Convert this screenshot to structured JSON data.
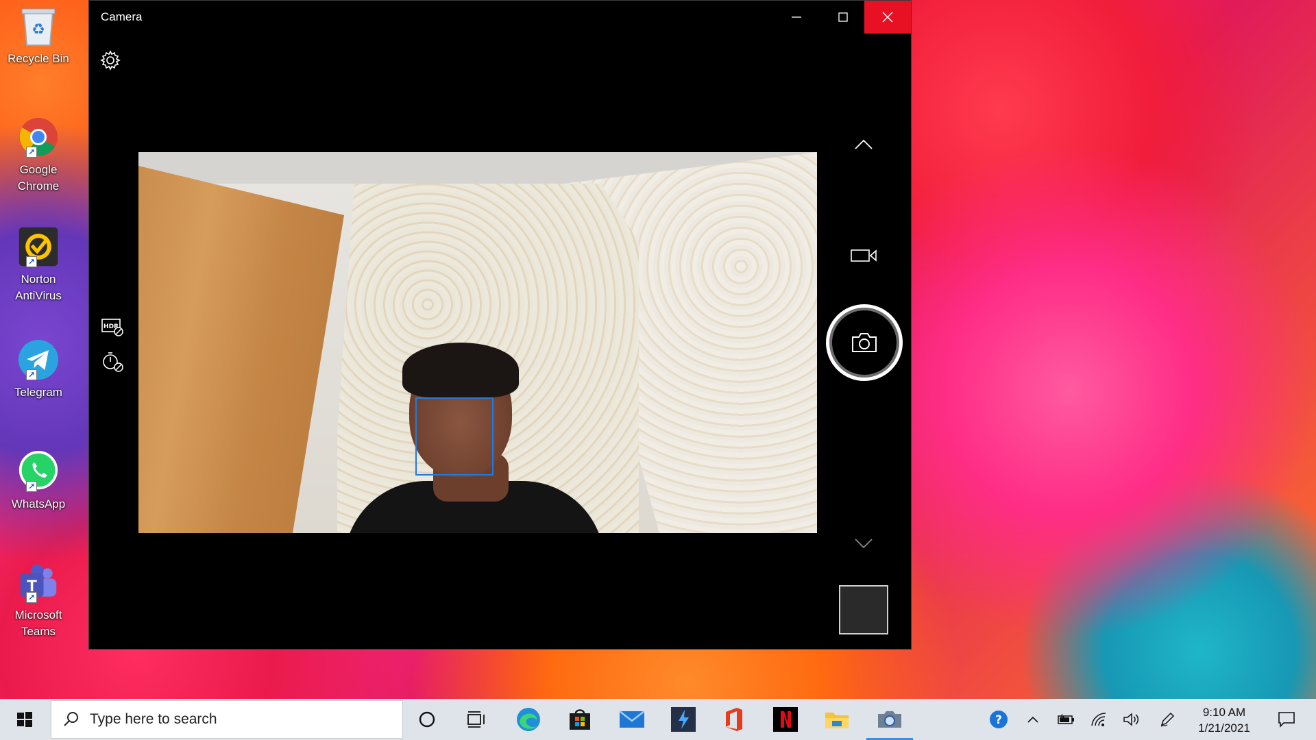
{
  "desktop": {
    "icons": [
      {
        "label": "Recycle Bin"
      },
      {
        "label": "Google Chrome"
      },
      {
        "label": "Norton AntiVirus"
      },
      {
        "label": "Telegram"
      },
      {
        "label": "WhatsApp"
      },
      {
        "label": "Microsoft Teams"
      }
    ]
  },
  "camera_window": {
    "title": "Camera",
    "controls": {
      "minimize": "minimize",
      "maximize": "maximize",
      "close": "close"
    },
    "left_toolbar": [
      "settings-icon",
      "hdr-off-icon",
      "timer-off-icon"
    ],
    "right_toolbar": [
      "chevron-up-icon",
      "video-mode-icon",
      "photo-capture-icon",
      "chevron-down-icon"
    ]
  },
  "taskbar": {
    "search_placeholder": "Type here to search",
    "pinned": [
      "cortana",
      "task-view",
      "edge",
      "store",
      "mail",
      "app",
      "office",
      "netflix",
      "file-explorer",
      "camera"
    ],
    "clock": {
      "time": "9:10 AM",
      "date": "1/21/2021"
    }
  },
  "colors": {
    "close_button": "#e81123",
    "face_box": "#1e7be0",
    "taskbar_bg": "#dfe3ea",
    "active_indicator": "#3a8ee6"
  }
}
